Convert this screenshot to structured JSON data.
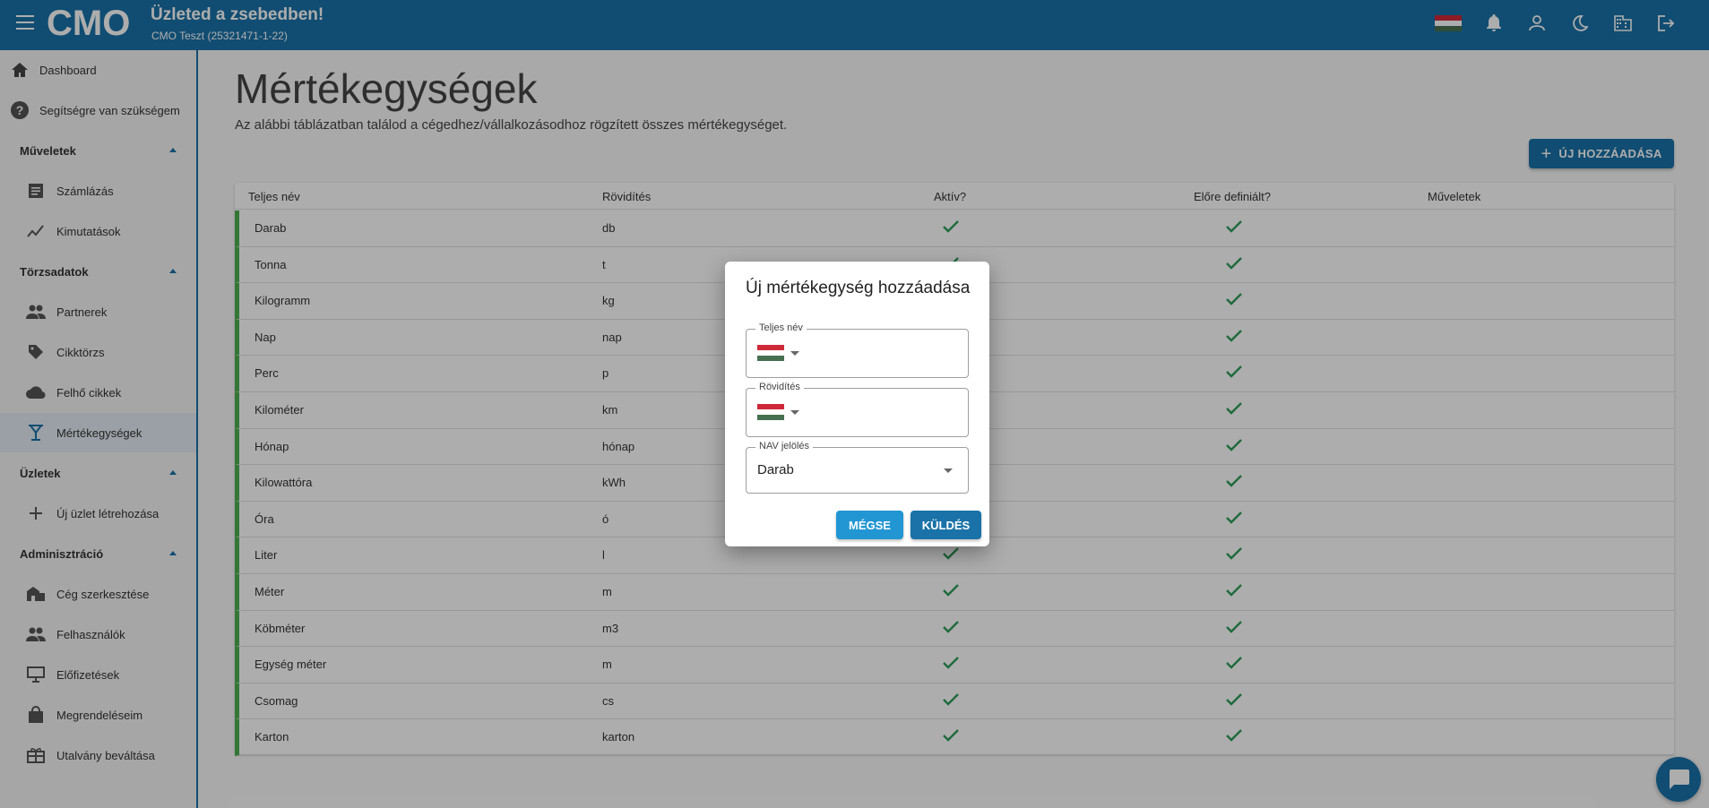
{
  "header": {
    "title": "Üzleted a zsebedben!",
    "subtitle": "CMO Teszt (25321471-1-22)",
    "logo_text": "CMO",
    "icons": [
      "hungarian-flag-icon",
      "bell-icon",
      "account-icon",
      "dark-mode-icon",
      "company-icon",
      "logout-icon"
    ]
  },
  "sidebar": {
    "items": [
      {
        "label": "Dashboard",
        "icon": "home-icon"
      },
      {
        "label": "Segítségre van szükségem",
        "icon": "help-icon"
      },
      {
        "label": "Műveletek",
        "section": true
      },
      {
        "label": "Számlázás",
        "icon": "receipt-icon"
      },
      {
        "label": "Kimutatások",
        "icon": "chart-line-icon"
      },
      {
        "label": "Törzsadatok",
        "section": true
      },
      {
        "label": "Partnerek",
        "icon": "people-icon"
      },
      {
        "label": "Cikktörzs",
        "icon": "tag-icon"
      },
      {
        "label": "Felhő cikkek",
        "icon": "cloud-icon"
      },
      {
        "label": "Mértékegységek",
        "icon": "scale-icon",
        "active": true
      },
      {
        "label": "Üzletek",
        "section": true
      },
      {
        "label": "Új üzlet létrehozása",
        "icon": "plus-icon"
      },
      {
        "label": "Adminisztráció",
        "section": true
      },
      {
        "label": "Cég szerkesztése",
        "icon": "business-icon"
      },
      {
        "label": "Felhasználók",
        "icon": "people-icon"
      },
      {
        "label": "Előfizetések",
        "icon": "subscription-icon"
      },
      {
        "label": "Megrendeléseim",
        "icon": "bag-icon"
      },
      {
        "label": "Utalvány beváltása",
        "icon": "gift-icon"
      }
    ]
  },
  "main": {
    "title": "Mértékegységek",
    "description": "Az alábbi táblázatban találod a cégedhez/vállalkozásodhoz rögzített összes mértékegységet.",
    "add_button": "ÚJ HOZZÁADÁSA",
    "table": {
      "headers": [
        "Teljes név",
        "Rövidítés",
        "Aktív?",
        "Előre definiált?",
        "Műveletek"
      ],
      "rows": [
        {
          "name": "Darab",
          "abbr": "db",
          "active": true,
          "predefined": true
        },
        {
          "name": "Tonna",
          "abbr": "t",
          "active": true,
          "predefined": true
        },
        {
          "name": "Kilogramm",
          "abbr": "kg",
          "active": true,
          "predefined": true
        },
        {
          "name": "Nap",
          "abbr": "nap",
          "active": true,
          "predefined": true
        },
        {
          "name": "Perc",
          "abbr": "p",
          "active": true,
          "predefined": true
        },
        {
          "name": "Kilométer",
          "abbr": "km",
          "active": true,
          "predefined": true
        },
        {
          "name": "Hónap",
          "abbr": "hónap",
          "active": true,
          "predefined": true
        },
        {
          "name": "Kilowattóra",
          "abbr": "kWh",
          "active": true,
          "predefined": true
        },
        {
          "name": "Óra",
          "abbr": "ó",
          "active": true,
          "predefined": true
        },
        {
          "name": "Liter",
          "abbr": "l",
          "active": true,
          "predefined": true
        },
        {
          "name": "Méter",
          "abbr": "m",
          "active": true,
          "predefined": true
        },
        {
          "name": "Köbméter",
          "abbr": "m3",
          "active": true,
          "predefined": true
        },
        {
          "name": "Egység méter",
          "abbr": "m",
          "active": true,
          "predefined": true
        },
        {
          "name": "Csomag",
          "abbr": "cs",
          "active": true,
          "predefined": true
        },
        {
          "name": "Karton",
          "abbr": "karton",
          "active": true,
          "predefined": true
        }
      ]
    }
  },
  "dialog": {
    "title": "Új mértékegység hozzáadása",
    "full_name_label": "Teljes név",
    "abbr_label": "Rövidítés",
    "nav_label": "NAV jelölés",
    "nav_value": "Darab",
    "cancel_button": "MÉGSE",
    "submit_button": "KÜLDÉS"
  },
  "colors": {
    "primary": "#1a72a8",
    "secondary": "#2196d3",
    "row_accent": "#4caf50",
    "check": "#2e9d5a"
  }
}
